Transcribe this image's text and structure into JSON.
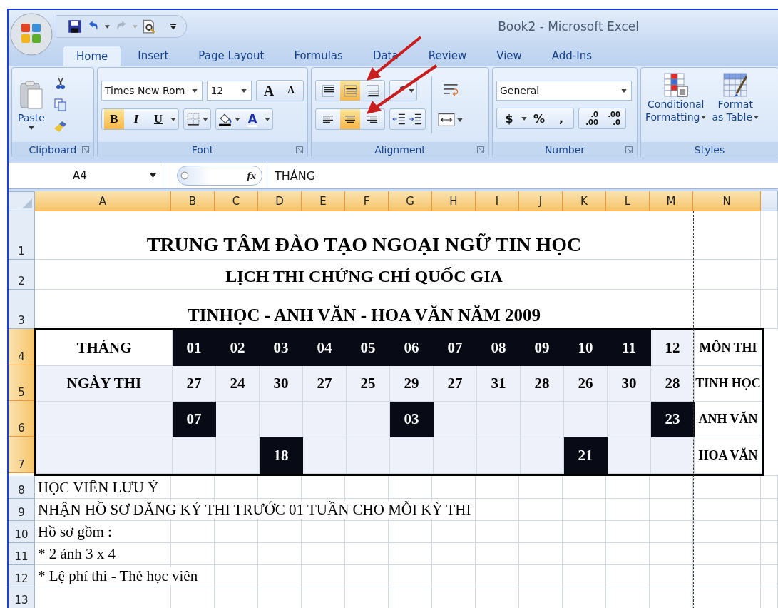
{
  "window": {
    "title": "Book2 - Microsoft Excel"
  },
  "tabs": [
    {
      "label": "Home",
      "selected": true
    },
    {
      "label": "Insert",
      "selected": false
    },
    {
      "label": "Page Layout",
      "selected": false
    },
    {
      "label": "Formulas",
      "selected": false
    },
    {
      "label": "Data",
      "selected": false
    },
    {
      "label": "Review",
      "selected": false
    },
    {
      "label": "View",
      "selected": false
    },
    {
      "label": "Add-Ins",
      "selected": false
    }
  ],
  "ribbon": {
    "clipboard": {
      "label": "Clipboard",
      "paste": "Paste"
    },
    "font": {
      "label": "Font",
      "font_name": "Times New Rom",
      "font_size": "12",
      "grow": "A",
      "shrink": "A",
      "styles": [
        {
          "label": "B",
          "selected": true
        },
        {
          "label": "I",
          "selected": false
        },
        {
          "label": "U",
          "selected": false
        }
      ],
      "font_color": "A"
    },
    "alignment": {
      "label": "Alignment",
      "vertical": [
        {
          "kind": "top",
          "selected": false
        },
        {
          "kind": "middle",
          "selected": true
        },
        {
          "kind": "bottom",
          "selected": false
        }
      ],
      "horizontal": [
        {
          "kind": "left",
          "selected": false
        },
        {
          "kind": "center",
          "selected": true
        },
        {
          "kind": "right",
          "selected": false
        }
      ]
    },
    "number": {
      "label": "Number",
      "format": "General",
      "buttons": [
        "$",
        "%",
        ","
      ],
      "decimals": [
        {
          "top": ".0",
          "bottom": ".00"
        },
        {
          "top": ".00",
          "bottom": ".0"
        }
      ]
    },
    "styles": {
      "label": "Styles",
      "buttons": [
        {
          "line1": "Conditional",
          "line2": "Formatting"
        },
        {
          "line1": "Format",
          "line2": "as Table"
        }
      ]
    }
  },
  "formula_bar": {
    "name_box": "A4",
    "fx": "fx",
    "value": "THÁNG"
  },
  "columns": [
    {
      "label": "A",
      "selected": true
    },
    {
      "label": "B",
      "selected": true
    },
    {
      "label": "C",
      "selected": true
    },
    {
      "label": "D",
      "selected": true
    },
    {
      "label": "E",
      "selected": true
    },
    {
      "label": "F",
      "selected": true
    },
    {
      "label": "G",
      "selected": true
    },
    {
      "label": "H",
      "selected": true
    },
    {
      "label": "I",
      "selected": true
    },
    {
      "label": "J",
      "selected": true
    },
    {
      "label": "K",
      "selected": true
    },
    {
      "label": "L",
      "selected": true
    },
    {
      "label": "M",
      "selected": true
    },
    {
      "label": "N",
      "selected": true
    }
  ],
  "rows": [
    {
      "number": "1",
      "selected": false,
      "kind": "title",
      "text": "TRUNG TÂM ĐÀO TẠO NGOẠI NGỮ TIN HỌC"
    },
    {
      "number": "2",
      "selected": false,
      "kind": "title",
      "text": "LỊCH THI CHỨNG CHỈ QUỐC GIA"
    },
    {
      "number": "3",
      "selected": false,
      "kind": "title",
      "text": "TINHỌC - ANH VĂN - HOA VĂN NĂM 2009"
    },
    {
      "number": "4",
      "selected": true,
      "kind": "schedule",
      "label": "THÁNG",
      "label_active": true,
      "side": "MÔN THI",
      "cells": [
        {
          "text": "01",
          "inverted": true
        },
        {
          "text": "02",
          "inverted": true
        },
        {
          "text": "03",
          "inverted": true
        },
        {
          "text": "04",
          "inverted": true
        },
        {
          "text": "05",
          "inverted": true
        },
        {
          "text": "06",
          "inverted": true
        },
        {
          "text": "07",
          "inverted": true
        },
        {
          "text": "08",
          "inverted": true
        },
        {
          "text": "09",
          "inverted": true
        },
        {
          "text": "10",
          "inverted": true
        },
        {
          "text": "11",
          "inverted": true
        },
        {
          "text": "12",
          "inverted": false
        }
      ]
    },
    {
      "number": "5",
      "selected": true,
      "kind": "schedule",
      "label": "NGÀY THI",
      "label_active": false,
      "side": "TINH HỌC",
      "cells": [
        {
          "text": "27",
          "inverted": false
        },
        {
          "text": "24",
          "inverted": false
        },
        {
          "text": "30",
          "inverted": false
        },
        {
          "text": "27",
          "inverted": false
        },
        {
          "text": "25",
          "inverted": false
        },
        {
          "text": "29",
          "inverted": false
        },
        {
          "text": "27",
          "inverted": false
        },
        {
          "text": "31",
          "inverted": false
        },
        {
          "text": "28",
          "inverted": false
        },
        {
          "text": "26",
          "inverted": false
        },
        {
          "text": "30",
          "inverted": false
        },
        {
          "text": "28",
          "inverted": false
        }
      ]
    },
    {
      "number": "6",
      "selected": true,
      "kind": "schedule",
      "label_active": false,
      "side": "ANH VĂN",
      "cells": [
        {
          "text": "07",
          "inverted": true
        },
        {
          "inverted": false
        },
        {
          "inverted": false
        },
        {
          "inverted": false
        },
        {
          "inverted": false
        },
        {
          "text": "03",
          "inverted": true
        },
        {
          "inverted": false
        },
        {
          "inverted": false
        },
        {
          "inverted": false
        },
        {
          "inverted": false
        },
        {
          "inverted": false
        },
        {
          "text": "23",
          "inverted": true
        }
      ]
    },
    {
      "number": "7",
      "selected": true,
      "kind": "schedule",
      "label_active": false,
      "side": "HOA VĂN",
      "cells": [
        {
          "inverted": false
        },
        {
          "inverted": false
        },
        {
          "text": "18",
          "inverted": true
        },
        {
          "inverted": false
        },
        {
          "inverted": false
        },
        {
          "inverted": false
        },
        {
          "inverted": false
        },
        {
          "inverted": false
        },
        {
          "inverted": false
        },
        {
          "text": "21",
          "inverted": true
        },
        {
          "inverted": false
        },
        {
          "inverted": false
        }
      ]
    },
    {
      "number": "8",
      "selected": false,
      "kind": "note",
      "text": "HỌC VIÊN LƯU Ý"
    },
    {
      "number": "9",
      "selected": false,
      "kind": "note",
      "text": "NHẬN HỒ SƠ ĐĂNG KÝ THI TRƯỚC 01 TUẦN CHO MỖI KỲ THI"
    },
    {
      "number": "10",
      "selected": false,
      "kind": "note",
      "text": "Hồ sơ gồm :"
    },
    {
      "number": "11",
      "selected": false,
      "kind": "note",
      "text": "* 2 ảnh 3 x 4"
    },
    {
      "number": "12",
      "selected": false,
      "kind": "note",
      "text": "* Lệ phí thi - Thẻ học viên"
    },
    {
      "number": "13",
      "selected": false,
      "kind": "note"
    }
  ]
}
